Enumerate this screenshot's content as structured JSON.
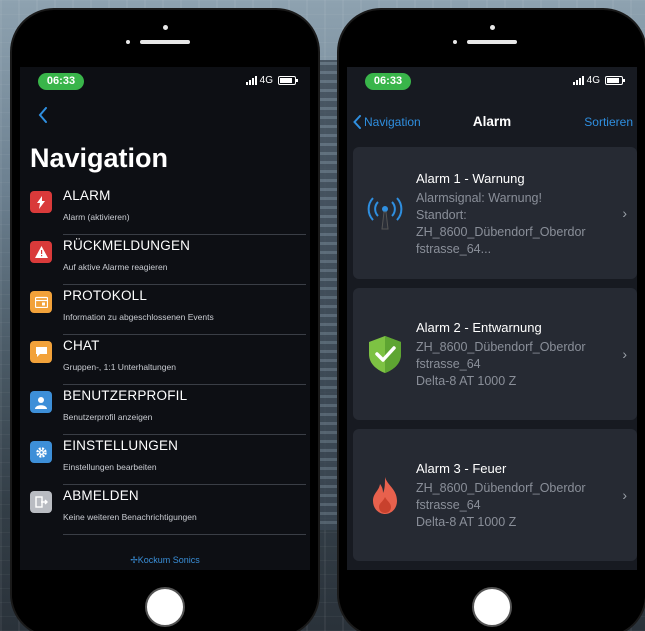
{
  "left_phone": {
    "status": {
      "time": "06:33",
      "network": "4G"
    },
    "title": "Navigation",
    "items": [
      {
        "label": "ALARM",
        "sub": "Alarm (aktivieren)",
        "icon": "lightning-icon",
        "color": "#d93a3a"
      },
      {
        "label": "RÜCKMELDUNGEN",
        "sub": "Auf aktive Alarme reagieren",
        "icon": "warning-icon",
        "color": "#d93a3a"
      },
      {
        "label": "PROTOKOLL",
        "sub": "Information zu abgeschlossenen Events",
        "icon": "calendar-icon",
        "color": "#f2a23a"
      },
      {
        "label": "CHAT",
        "sub": "Gruppen-, 1:1 Unterhaltungen",
        "icon": "chat-icon",
        "color": "#f2a23a"
      },
      {
        "label": "BENUTZERPROFIL",
        "sub": "Benutzerprofil anzeigen",
        "icon": "user-icon",
        "color": "#3d8fd8"
      },
      {
        "label": "EINSTELLUNGEN",
        "sub": "Einstellungen bearbeiten",
        "icon": "gear-icon",
        "color": "#3d8fd8"
      },
      {
        "label": "ABMELDEN",
        "sub": "Keine weiteren Benachrichtigungen",
        "icon": "logout-icon",
        "color": "#b9bcc2"
      }
    ],
    "footer": "Kockum Sonics"
  },
  "right_phone": {
    "status": {
      "time": "06:33",
      "network": "4G"
    },
    "nav": {
      "back_label": "Navigation",
      "title": "Alarm",
      "action_label": "Sortieren"
    },
    "alarms": [
      {
        "title": "Alarm 1 - Warnung",
        "lines": [
          "Alarmsignal: Warnung!",
          "Standort:",
          "ZH_8600_Dübendorf_Oberdor",
          "fstrasse_64..."
        ],
        "icon": "antenna-icon"
      },
      {
        "title": "Alarm 2 - Entwarnung",
        "lines": [
          "ZH_8600_Dübendorf_Oberdor",
          "fstrasse_64",
          "Delta-8 AT 1000 Z"
        ],
        "icon": "shield-check-icon"
      },
      {
        "title": "Alarm 3 - Feuer",
        "lines": [
          "ZH_8600_Dübendorf_Oberdor",
          "fstrasse_64",
          "Delta-8 AT 1000 Z"
        ],
        "icon": "fire-icon"
      }
    ]
  }
}
